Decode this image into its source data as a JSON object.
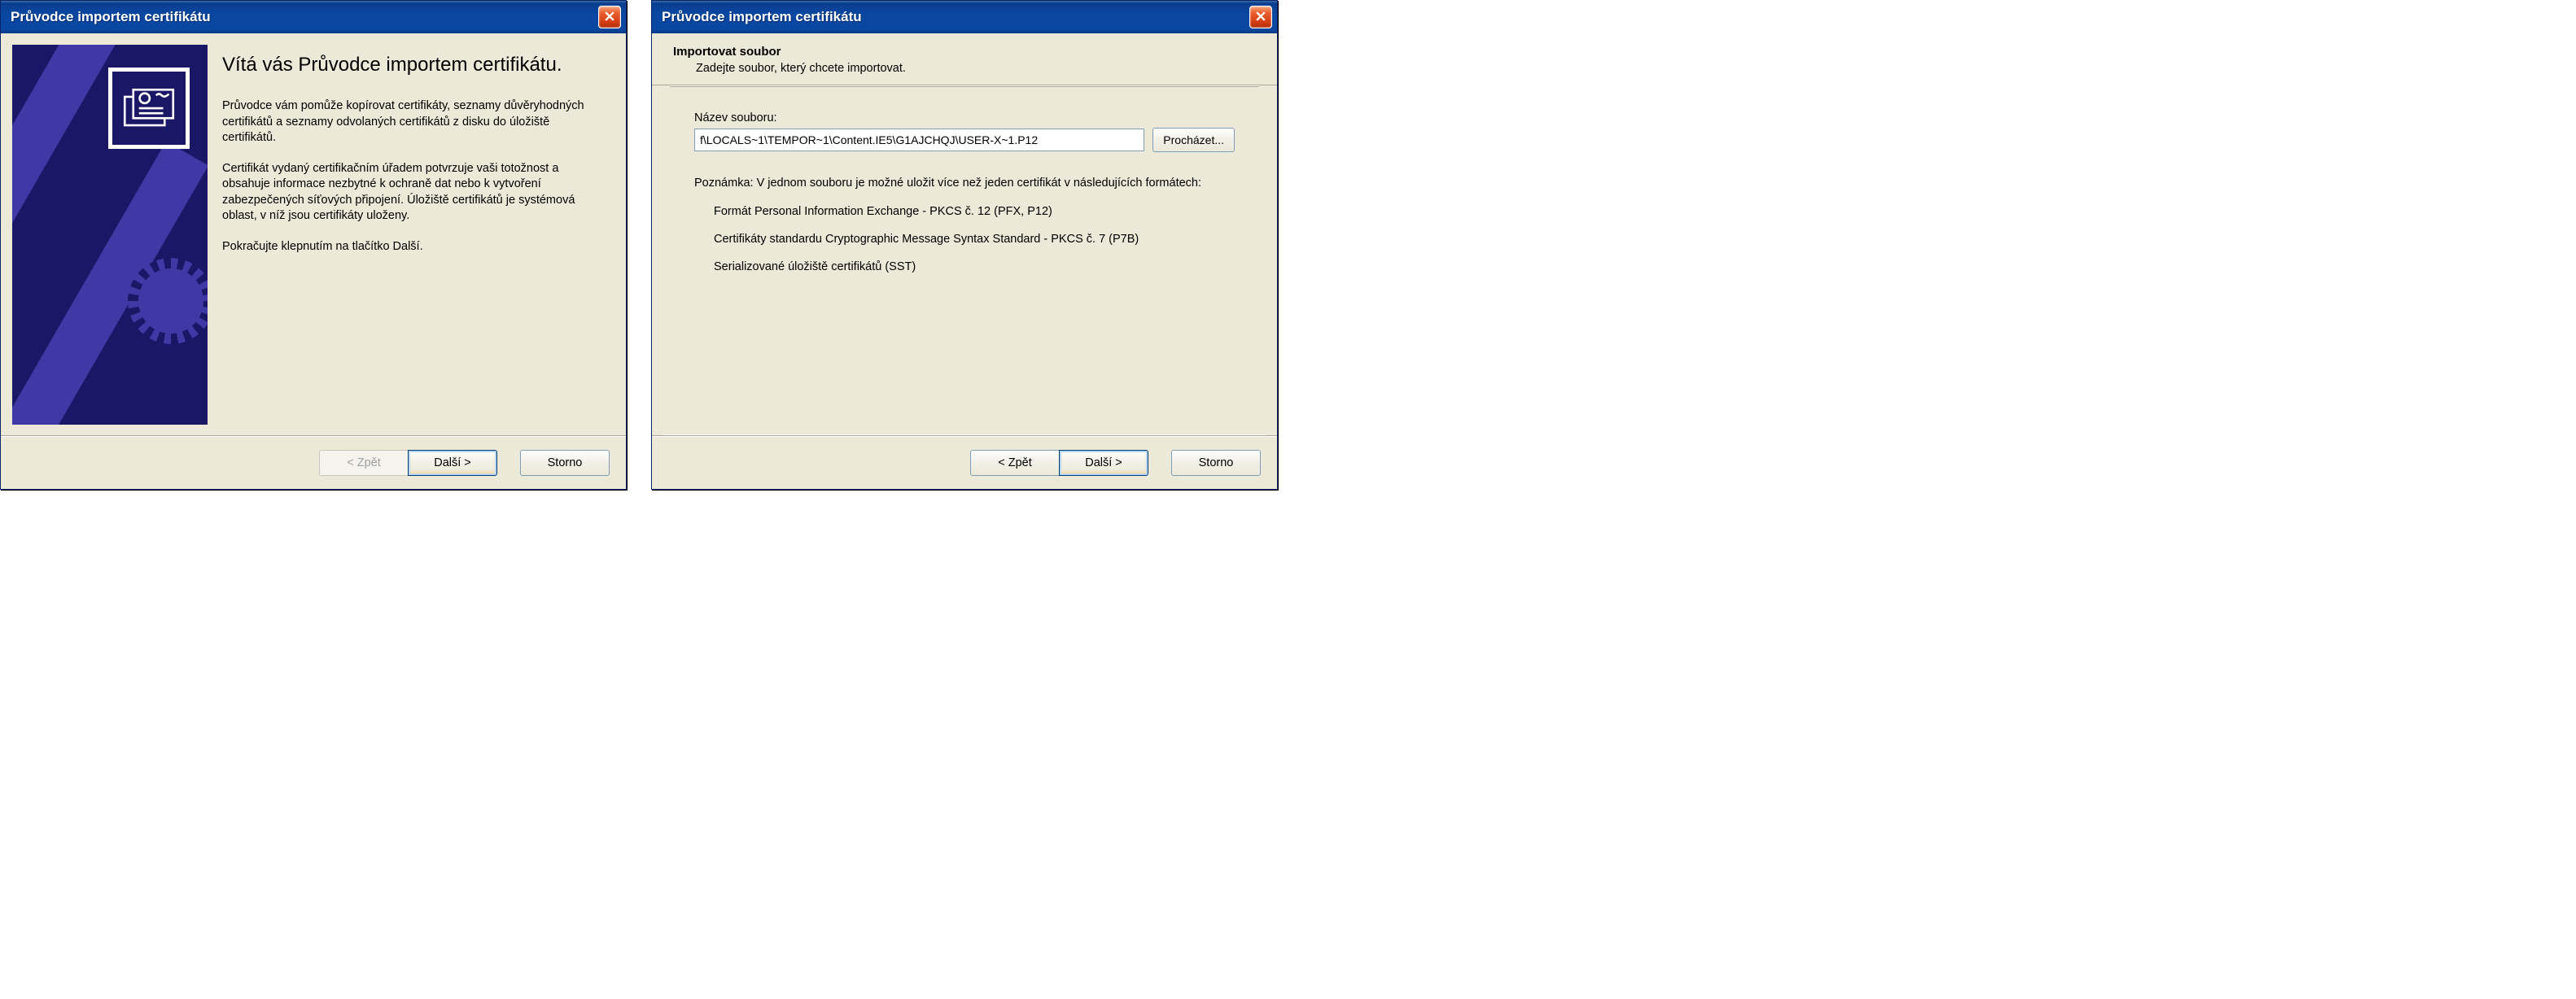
{
  "window1": {
    "title": "Průvodce importem certifikátu",
    "heading": "Vítá vás Průvodce importem certifikátu.",
    "para1": "Průvodce vám pomůže kopírovat certifikáty, seznamy důvěryhodných certifikátů a seznamy odvolaných certifikátů z disku do úložiště certifikátů.",
    "para2": "Certifikát vydaný certifikačním úřadem potvrzuje vaši totožnost a obsahuje informace nezbytné k ochraně dat nebo k vytvoření zabezpečených síťových připojení. Úložiště certifikátů je systémová oblast, v níž jsou certifikáty uloženy.",
    "para3": "Pokračujte klepnutím na tlačítko Další.",
    "buttons": {
      "back": "< Zpět",
      "next": "Další >",
      "cancel": "Storno"
    }
  },
  "window2": {
    "title": "Průvodce importem certifikátu",
    "header_title": "Importovat soubor",
    "header_sub": "Zadejte soubor, který chcete importovat.",
    "file_label": "Název souboru:",
    "file_value": "f\\LOCALS~1\\TEMPOR~1\\Content.IE5\\G1AJCHQJ\\USER-X~1.P12",
    "browse": "Procházet...",
    "note": "Poznámka: V jednom souboru je možné uložit více než jeden certifikát v následujících formátech:",
    "formats": {
      "0": "Formát Personal Information Exchange - PKCS č. 12 (PFX, P12)",
      "1": "Certifikáty standardu Cryptographic Message Syntax Standard - PKCS č. 7 (P7B)",
      "2": "Serializované úložiště certifikátů (SST)"
    },
    "buttons": {
      "back": "< Zpět",
      "next": "Další >",
      "cancel": "Storno"
    }
  }
}
